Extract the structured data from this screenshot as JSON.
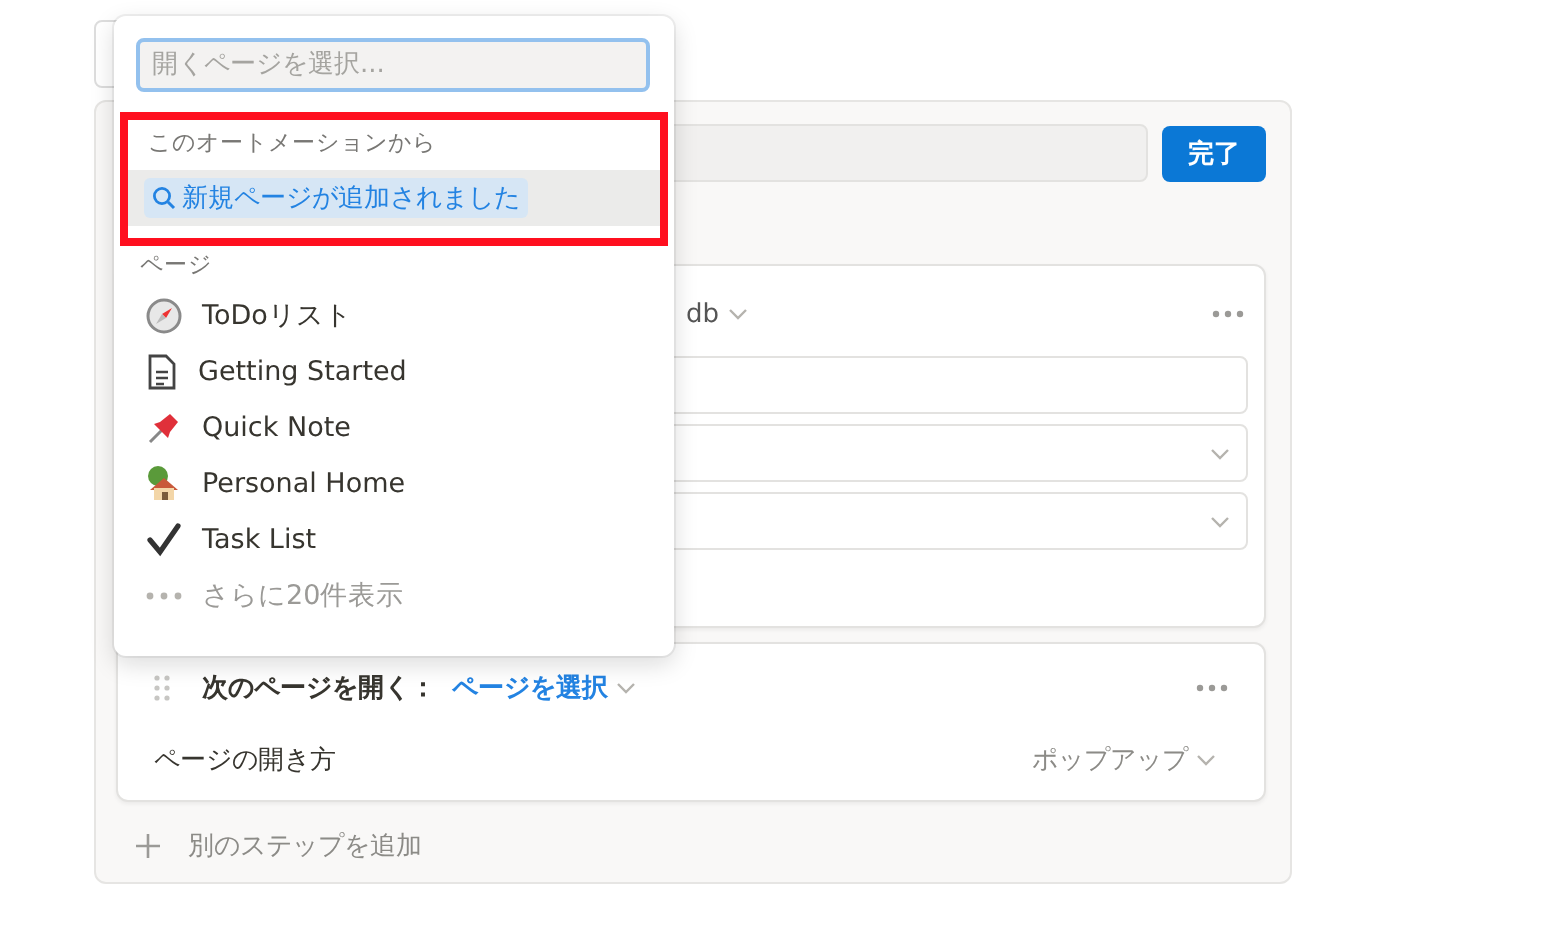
{
  "editor": {
    "done_button": "完了",
    "card": {
      "title_tail": "db"
    },
    "open_step": {
      "label": "次のページを開く：",
      "page_select": "ページを選択",
      "option_label": "ページの開き方",
      "option_value": "ポップアップ"
    },
    "add_step": "別のステップを追加"
  },
  "dropdown": {
    "search": {
      "placeholder": "開くページを選択..."
    },
    "automation_section": "このオートメーションから",
    "automation_item": {
      "label": "新規ページが追加されました",
      "selected": true
    },
    "highlighted": true,
    "pages_section": "ページ",
    "pages": [
      {
        "label": "ToDoリスト"
      },
      {
        "label": "Getting Started"
      },
      {
        "label": "Quick Note"
      },
      {
        "label": "Personal Home"
      },
      {
        "label": "Task List"
      }
    ],
    "more": "さらに20件表示"
  }
}
